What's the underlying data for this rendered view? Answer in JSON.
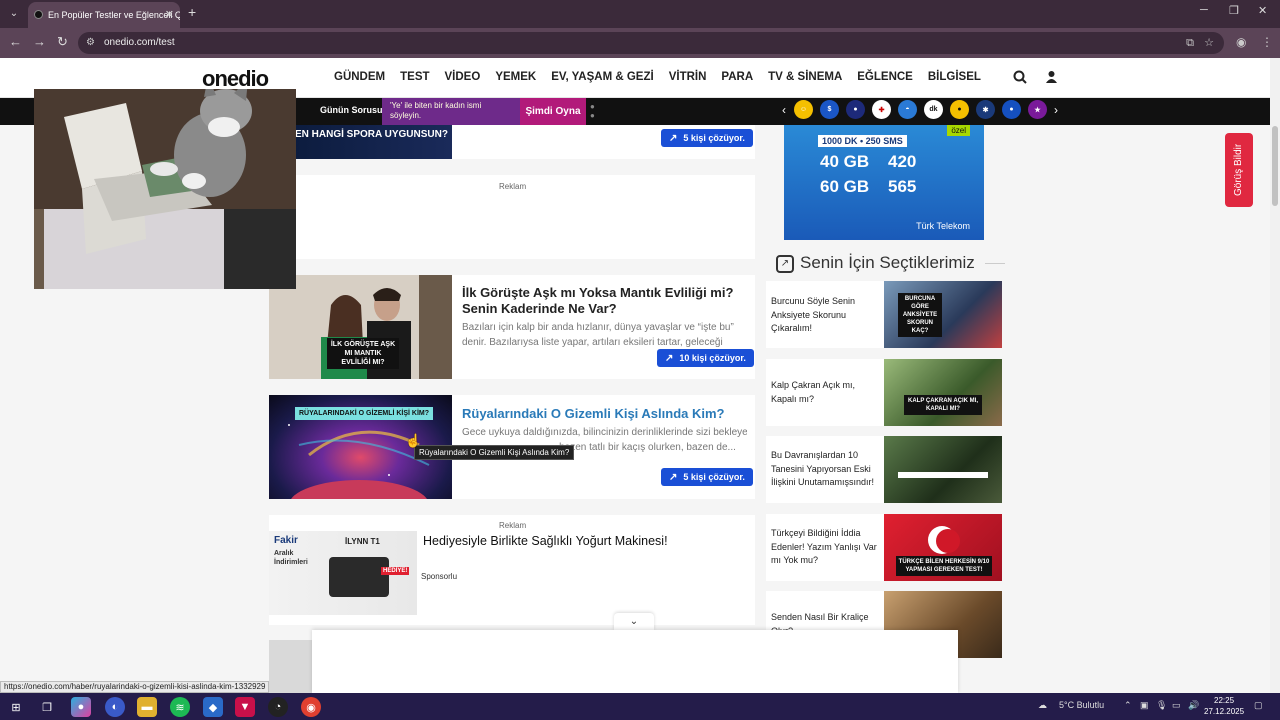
{
  "browser": {
    "tab_title": "En Popüler Testler ve Eğlenceli Q",
    "url": "onedio.com/test",
    "status_url": "https://onedio.com/haber/ruyalarindaki-o-gizemli-kisi-aslinda-kim-1332929"
  },
  "site": {
    "logo": "onedio",
    "nav": [
      "GÜNDEM",
      "TEST",
      "VİDEO",
      "YEMEK",
      "EV, YAŞAM & GEZİ",
      "VİTRİN",
      "PARA",
      "TV & SİNEMA",
      "EĞLENCE",
      "BİLGİSEL"
    ]
  },
  "strip": {
    "label": "Günün Sorusu",
    "question": "'Ye' ile biten bir kadın ismi söyleyin.",
    "play": "Şimdi Oyna"
  },
  "cards": {
    "top_thumb_text": "EN HANGİ SPORA UYGUNSUN?",
    "top_solve": "5 kişi çözüyor.",
    "reklam": "Reklam",
    "love": {
      "title": "İlk Görüşte Aşk mı Yoksa Mantık Evliliği mi? Senin Kaderinde Ne Var?",
      "desc": "Bazıları için kalp bir anda hızlanır, dünya yavaşlar ve “işte bu” denir. Bazılarıysa liste yapar, artıları eksileri tartar, geleceği planlar. Peki ...",
      "solve": "10 kişi çözüyor.",
      "thumb_text": "İLK GÖRÜŞTE AŞK MI MANTIK EVLİLİĞİ MI?"
    },
    "dream": {
      "title": "Rüyalarındaki O Gizemli Kişi Aslında Kim?",
      "desc_line1": "Gece uykuya daldığınızda, bilincinizin derinliklerinde sizi bekleyen",
      "desc_line2": "... bazen tatlı bir kaçış olurken, bazen de...",
      "solve": "5 kişi çözüyor.",
      "thumb_text": "RÜYALARINDAKİ O GİZEMLİ KİŞİ KİM?",
      "tooltip": "Rüyalarındaki O Gizemli Kişi Aslında Kim?"
    },
    "sponsor": {
      "reklam": "Reklam",
      "title": "Hediyesiyle Birlikte Sağlıklı Yoğurt Makinesi!",
      "sub": "Sponsorlu",
      "brand": "Fakir",
      "brand_sub": "Aralık İndirimleri",
      "badge": "HEDİYE!",
      "model": "İLYNN T1"
    }
  },
  "side": {
    "ad_tag": "özel",
    "ad_line1": "1000 DK • 250 SMS",
    "ad_line2a": "40 GB",
    "ad_line2b": "420",
    "ad_line3a": "60 GB",
    "ad_line3b": "565",
    "ad_brand": "Türk Telekom",
    "title": "Senin İçin Seçtiklerimiz",
    "items": [
      {
        "text": "Burcunu Söyle Senin Anksiyete Skorunu Çıkaralım!",
        "img_text": "BURCUNA GÖRE ANKSİYETE SKORUN KAÇ?",
        "color": "#5a7a9a"
      },
      {
        "text": "Kalp Çakran Açık mı, Kapalı mı?",
        "img_text": "KALP ÇAKRAN AÇIK MI, KAPALI MI?",
        "color": "#4a6a3a"
      },
      {
        "text": "Bu Davranışlardan 10 Tanesini Yapıyorsan Eski İlişkini Unutamamışsındır!",
        "img_text": "",
        "color": "#2f3f2a"
      },
      {
        "text": "Türkçeyi Bildiğini İddia Edenler! Yazım Yanlışı Var mı Yok mu?",
        "img_text": "TÜRKÇE BİLEN HERKESİN 9/10 YAPMASI GEREKEN TEST!",
        "color": "#c01020"
      },
      {
        "text": "Senden Nasıl Bir Kraliçe Olur?",
        "img_text": "",
        "color": "#8a6a3a"
      }
    ]
  },
  "feedback": "Görüş Bildir",
  "taskbar": {
    "weather": "5°C  Bulutlu",
    "time": "22:25",
    "date": "27.12.2025"
  }
}
